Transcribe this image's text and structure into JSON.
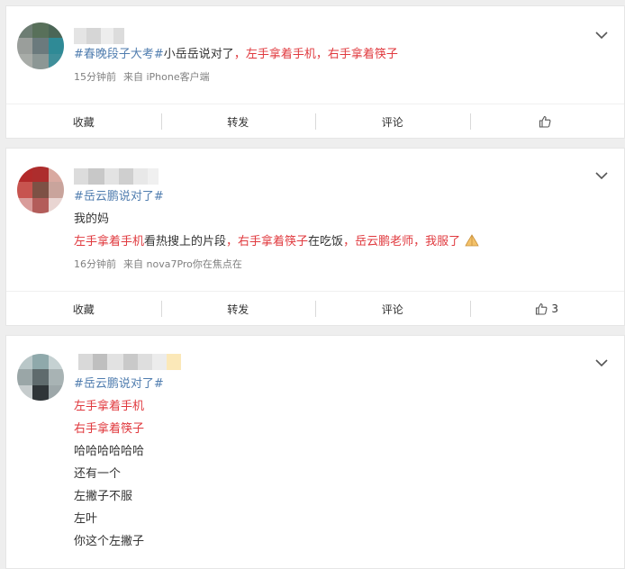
{
  "posts": [
    {
      "hashtag": "#春晚段子大考#",
      "text_parts": [
        "小岳岳说对了",
        "，左手拿着手机，右手拿着筷子"
      ],
      "meta": {
        "time": "15分钟前",
        "source": "来自 iPhone客户端"
      },
      "actions": {
        "collect": "收藏",
        "repost": "转发",
        "comment": "评论",
        "like_count": ""
      }
    },
    {
      "hashtag": "#岳云鹏说对了#",
      "line1": "我的妈",
      "line2_parts": [
        "左手拿着手机",
        "看热搜上的片段",
        "，右手拿着筷子",
        "在吃饭",
        "，岳云鹏老师",
        "，我服了"
      ],
      "meta": {
        "time": "16分钟前",
        "source": "来自 nova7Pro你在焦点在"
      },
      "actions": {
        "collect": "收藏",
        "repost": "转发",
        "comment": "评论",
        "like_count": "3"
      }
    },
    {
      "hashtag": "#岳云鹏说对了#",
      "lines": [
        "左手拿着手机",
        "右手拿着筷子",
        "哈哈哈哈哈哈",
        "还有一个",
        "左撇子不服",
        "左叶",
        "你这个左撇子"
      ]
    }
  ],
  "icons": {
    "chevron": "chevron-down-icon",
    "like": "thumbs-up-icon",
    "emoji": "praying-hands-emoji-icon"
  },
  "colors": {
    "hashtag": "#507daf",
    "highlight": "#e0393e",
    "meta": "#808080"
  }
}
